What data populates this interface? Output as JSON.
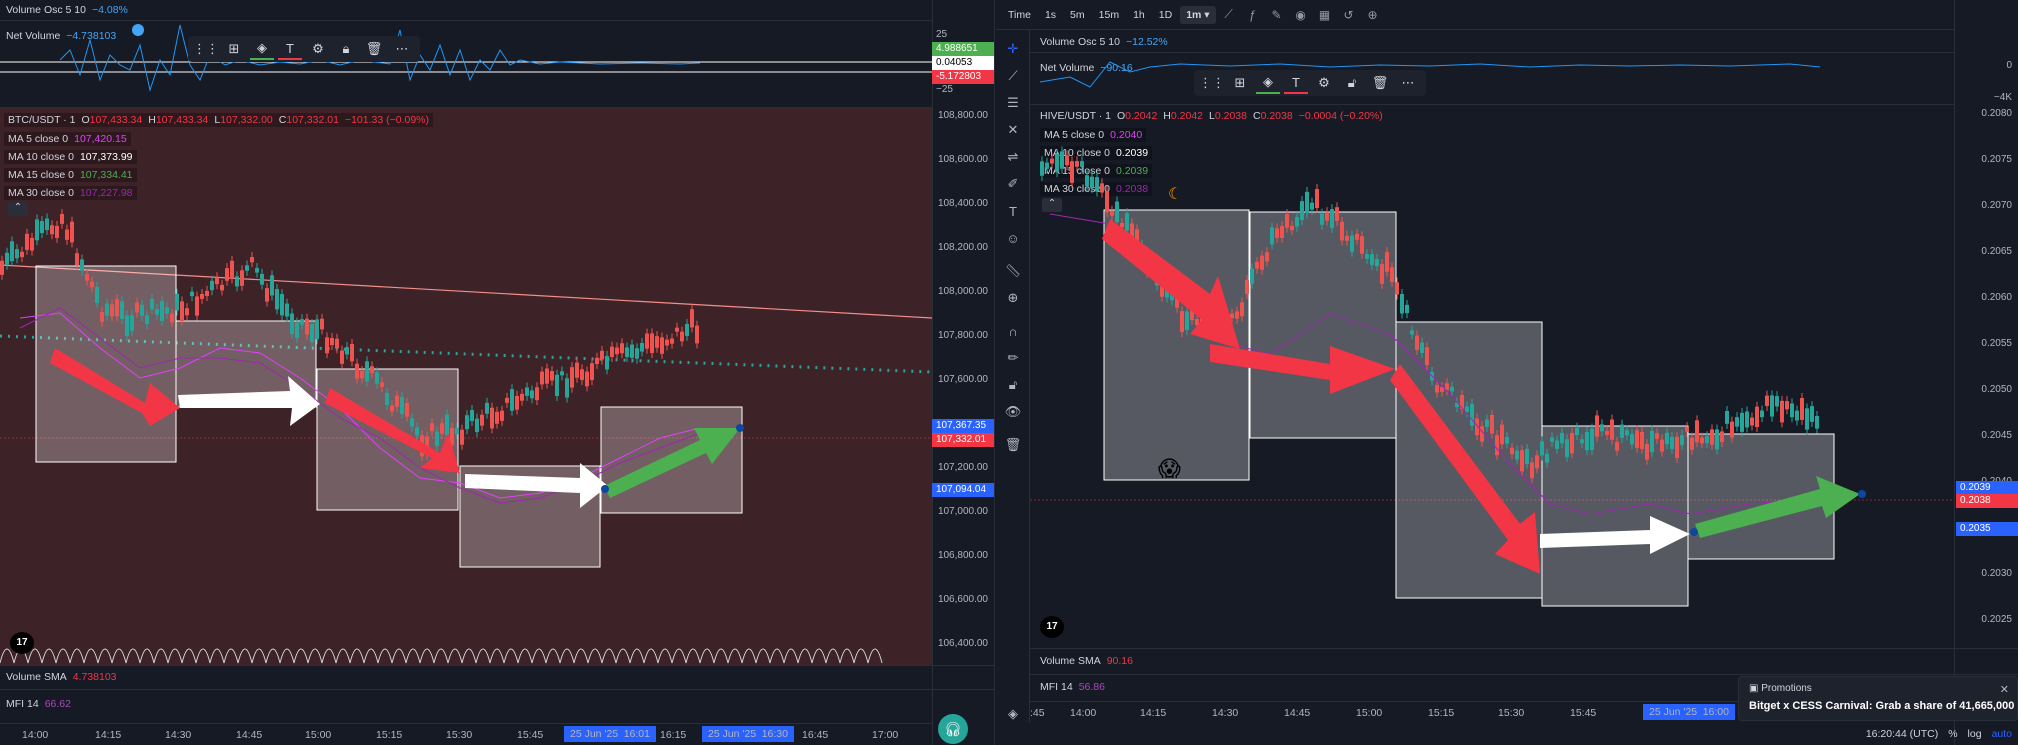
{
  "left": {
    "volosc": {
      "name": "Volume Osc 5 10",
      "value": "−4.08%"
    },
    "netvol": {
      "name": "Net Volume",
      "value": "−4.738103"
    },
    "netvol_scale": [
      "25",
      "4.988651",
      "0.04053",
      "-5.172803",
      "−25"
    ],
    "symbol": "BTC/USDT · 1",
    "ohlc": {
      "o_label": "O",
      "o": "107,433.34",
      "h_label": "H",
      "h": "107,433.34",
      "l_label": "L",
      "l": "107,332.00",
      "c_label": "C",
      "c": "107,332.01",
      "chg": "−101.33 (−0.09%)"
    },
    "mas": [
      {
        "name": "MA 5 close 0",
        "value": "107,420.15",
        "color": "#e040fb"
      },
      {
        "name": "MA 10 close 0",
        "value": "107,373.99",
        "color": "#ffffff"
      },
      {
        "name": "MA 15 close 0",
        "value": "107,334.41",
        "color": "#4caf50"
      },
      {
        "name": "MA 30 close 0",
        "value": "107,227.98",
        "color": "#9c27b0"
      }
    ],
    "price_ticks": [
      "108,800.00",
      "108,600.00",
      "108,400.00",
      "108,200.00",
      "108,000.00",
      "107,800.00",
      "107,600.00",
      "107,400.00",
      "107,200.00",
      "107,000.00",
      "106,800.00",
      "106,600.00",
      "106,400.00"
    ],
    "badges": [
      {
        "value": "107,367.35",
        "color": "#2962ff"
      },
      {
        "value": "107,332.01",
        "color": "#f23645"
      },
      {
        "value": "107,094.04",
        "color": "#2962ff"
      }
    ],
    "volsma": {
      "name": "Volume SMA",
      "value": "4.738103"
    },
    "mfi": {
      "name": "MFI 14",
      "value": "66.62"
    },
    "times": [
      "14:00",
      "14:15",
      "14:30",
      "14:45",
      "15:00",
      "15:15",
      "15:30",
      "15:45",
      "16:15",
      "16:45",
      "17:00"
    ],
    "time_hl": [
      "25 Jun '25",
      "16:01",
      "25 Jun '25",
      "16:30"
    ]
  },
  "right": {
    "toolbar": {
      "time_label": "Time",
      "tfs": [
        "1s",
        "5m",
        "15m",
        "1h",
        "1D",
        "1m ▾"
      ]
    },
    "volosc": {
      "name": "Volume Osc 5 10",
      "value": "−12.52%"
    },
    "netvol": {
      "name": "Net Volume",
      "value": "−90.16"
    },
    "netvol_scale": [
      "0",
      "−4K"
    ],
    "symbol": "HIVE/USDT · 1",
    "ohlc": {
      "o_label": "O",
      "o": "0.2042",
      "h_label": "H",
      "h": "0.2042",
      "l_label": "L",
      "l": "0.2038",
      "c_label": "C",
      "c": "0.2038",
      "chg": "−0.0004 (−0.20%)"
    },
    "mas": [
      {
        "name": "MA 5 close 0",
        "value": "0.2040",
        "color": "#e040fb"
      },
      {
        "name": "MA 10 close 0",
        "value": "0.2039",
        "color": "#ffffff"
      },
      {
        "name": "MA 15 close 0",
        "value": "0.2039",
        "color": "#4caf50"
      },
      {
        "name": "MA 30 close 0",
        "value": "0.2038",
        "color": "#9c27b0"
      }
    ],
    "price_ticks": [
      "0.2080",
      "0.2075",
      "0.2070",
      "0.2065",
      "0.2060",
      "0.2055",
      "0.2050",
      "0.2045",
      "0.2040",
      "0.2035",
      "0.2030",
      "0.2025"
    ],
    "badges": [
      {
        "value": "0.2039",
        "color": "#2962ff"
      },
      {
        "value": "0.2038",
        "color": "#f23645"
      },
      {
        "value": "0.2035",
        "color": "#2962ff"
      }
    ],
    "volsma": {
      "name": "Volume SMA",
      "value": "90.16"
    },
    "mfi": {
      "name": "MFI 14",
      "value": "56.86"
    },
    "times": [
      ":45",
      "14:00",
      "14:15",
      "14:30",
      "14:45",
      "15:00",
      "15:15",
      "15:30",
      "15:45"
    ],
    "time_hl": [
      "25 Jun '25",
      "16:00"
    ],
    "promo": {
      "title": "Promotions",
      "text": "Bitget x CESS Carnival: Grab a share of 41,665,000",
      "close": "✕"
    },
    "bottom": {
      "clock": "16:20:44 (UTC)",
      "pct": "%",
      "log": "log",
      "auto": "auto"
    }
  }
}
